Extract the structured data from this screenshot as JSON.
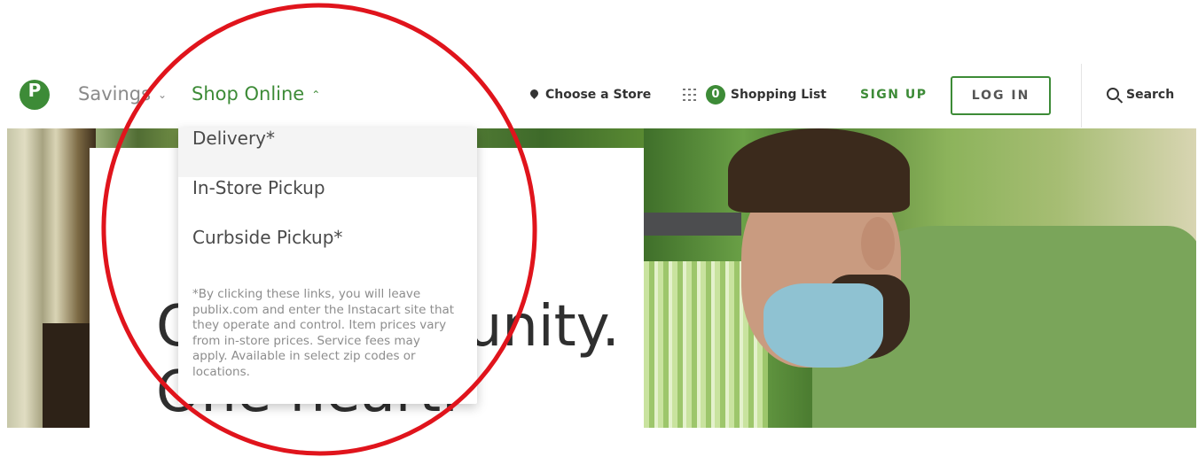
{
  "header": {
    "logo_letter": "P",
    "nav": {
      "savings": "Savings",
      "shop_online": "Shop Online"
    },
    "choose_store": "Choose a Store",
    "shopping_list": {
      "count": "0",
      "label": "Shopping List"
    },
    "sign_up": "SIGN UP",
    "log_in": "LOG IN",
    "search": "Search"
  },
  "dropdown": {
    "items": [
      {
        "label": "Delivery*"
      },
      {
        "label": "In-Store Pickup"
      },
      {
        "label": "Curbside Pickup*"
      }
    ],
    "note": "*By clicking these links, you will leave publix.com and enter the Instacart site that they operate and control. Item prices vary from in-store prices. Service fees may apply. Available in select zip codes or locations."
  },
  "hero": {
    "headline_line1": "One community.",
    "headline_line2": "One heart."
  },
  "colors": {
    "brand_green": "#3d8b37",
    "annotation_red": "#e0141c"
  }
}
